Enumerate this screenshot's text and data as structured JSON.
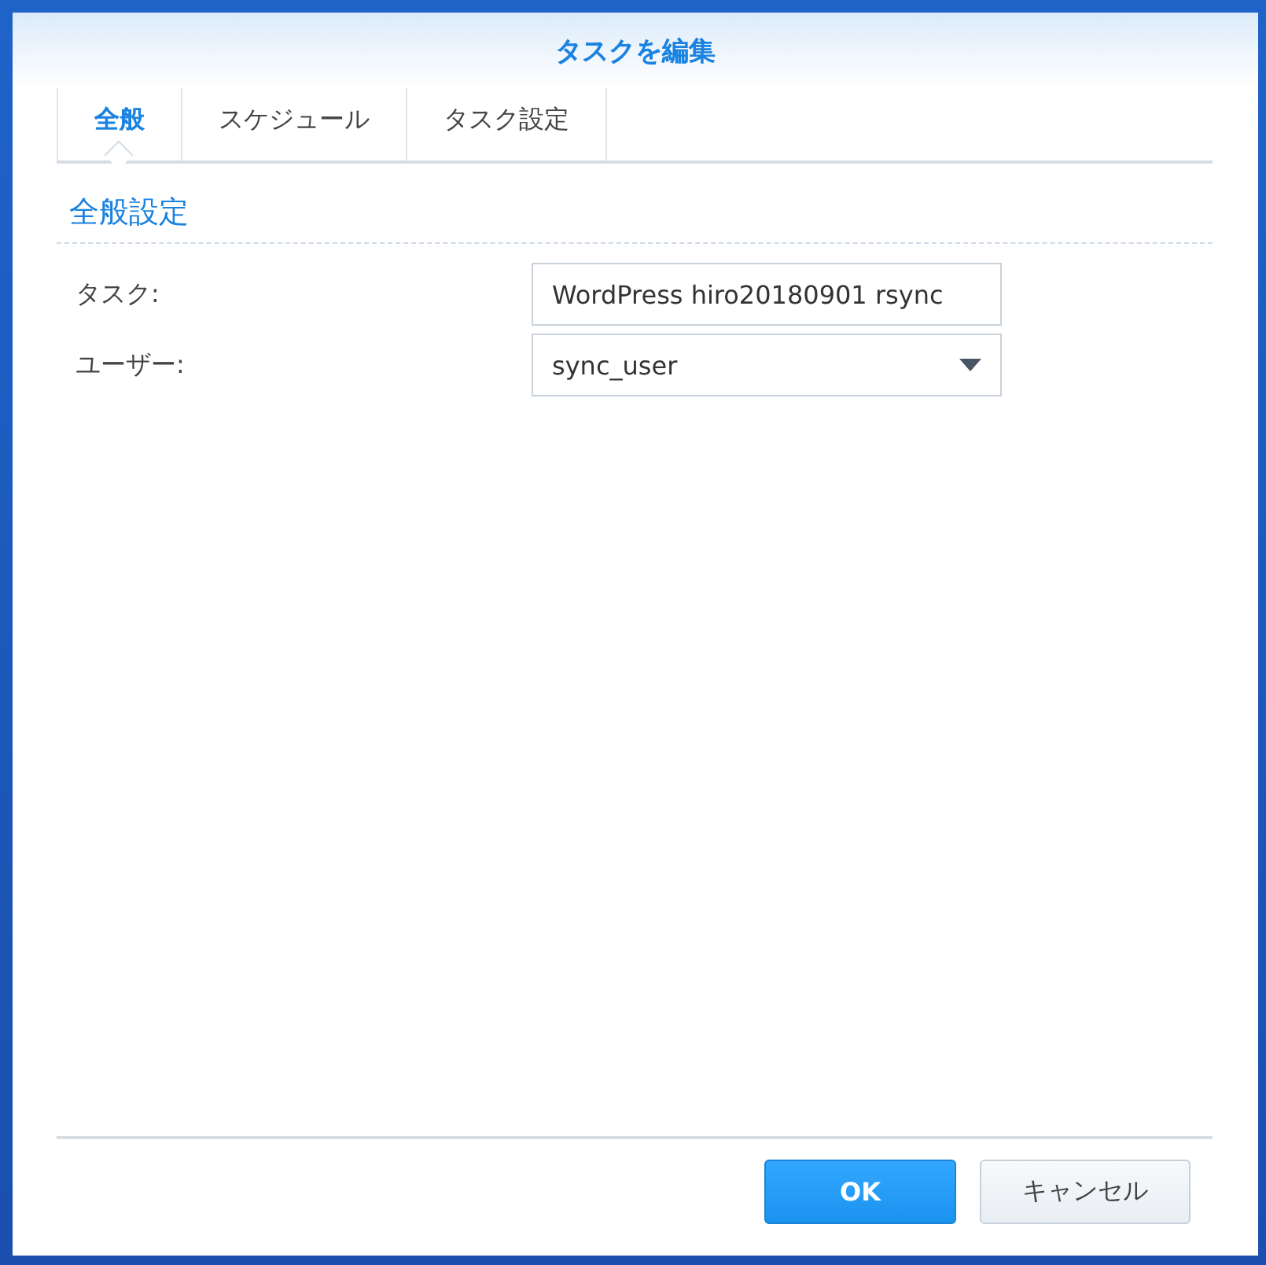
{
  "window": {
    "title": "タスクを編集"
  },
  "tabs": [
    {
      "label": "全般",
      "selected": true
    },
    {
      "label": "スケジュール",
      "selected": false
    },
    {
      "label": "タスク設定",
      "selected": false
    }
  ],
  "section": {
    "title": "全般設定"
  },
  "fields": [
    {
      "kind": "text",
      "label": "タスク:",
      "value": "WordPress hiro20180901 rsync"
    },
    {
      "kind": "dropdown",
      "label": "ユーザー:",
      "value": "sync_user"
    }
  ],
  "buttons": [
    {
      "label": "OK",
      "kind": "primary"
    },
    {
      "label": "キャンセル",
      "kind": "secondary"
    }
  ]
}
